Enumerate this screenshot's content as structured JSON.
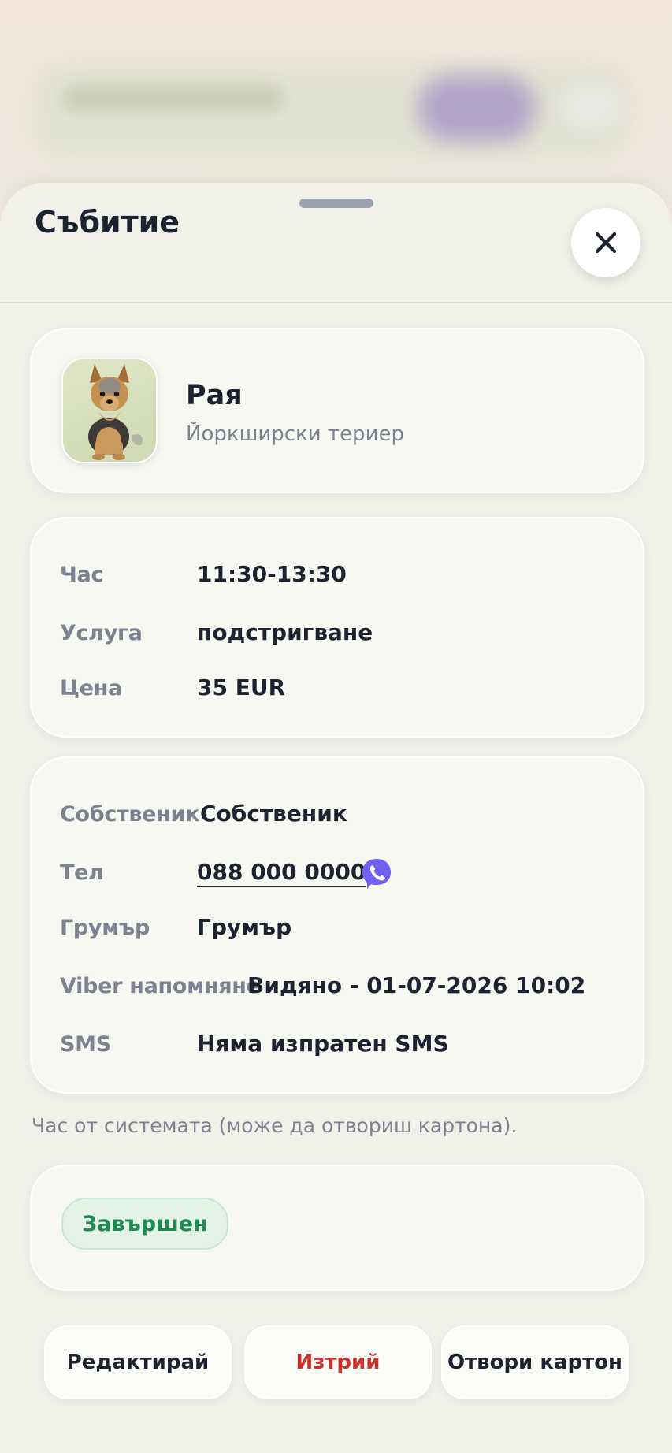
{
  "sheet": {
    "title": "Събитие"
  },
  "pet": {
    "name": "Рая",
    "breed": "Йоркширски териер",
    "avatar_icon": "yorkshire-terrier-photo"
  },
  "appointment": {
    "time_label": "Час",
    "time_value": "11:30-13:30",
    "service_label": "Услуга",
    "service_value": "подстригване",
    "price_label": "Цена",
    "price_value": "35 EUR"
  },
  "owner": {
    "owner_label": "Собственик",
    "owner_value": "Собственик",
    "phone_label": "Тел",
    "phone_value": "088 000 0000",
    "viber_icon": "viber-icon",
    "groomer_label": "Грумър",
    "groomer_value": "Грумър",
    "viber_reminder_label": "Viber напомняне",
    "viber_reminder_value": "Видяно - 01-07-2026 10:02",
    "sms_label": "SMS",
    "sms_value": "Няма изпратен SMS"
  },
  "note": "Час от системата (може да отвориш картона).",
  "status": {
    "label": "Завършен",
    "color": "#1e8a4f"
  },
  "actions": {
    "edit": "Редактирай",
    "delete": "Изтрий",
    "open_card": "Отвори картон"
  },
  "colors": {
    "viber": "#7360f2",
    "delete": "#c8322b"
  }
}
